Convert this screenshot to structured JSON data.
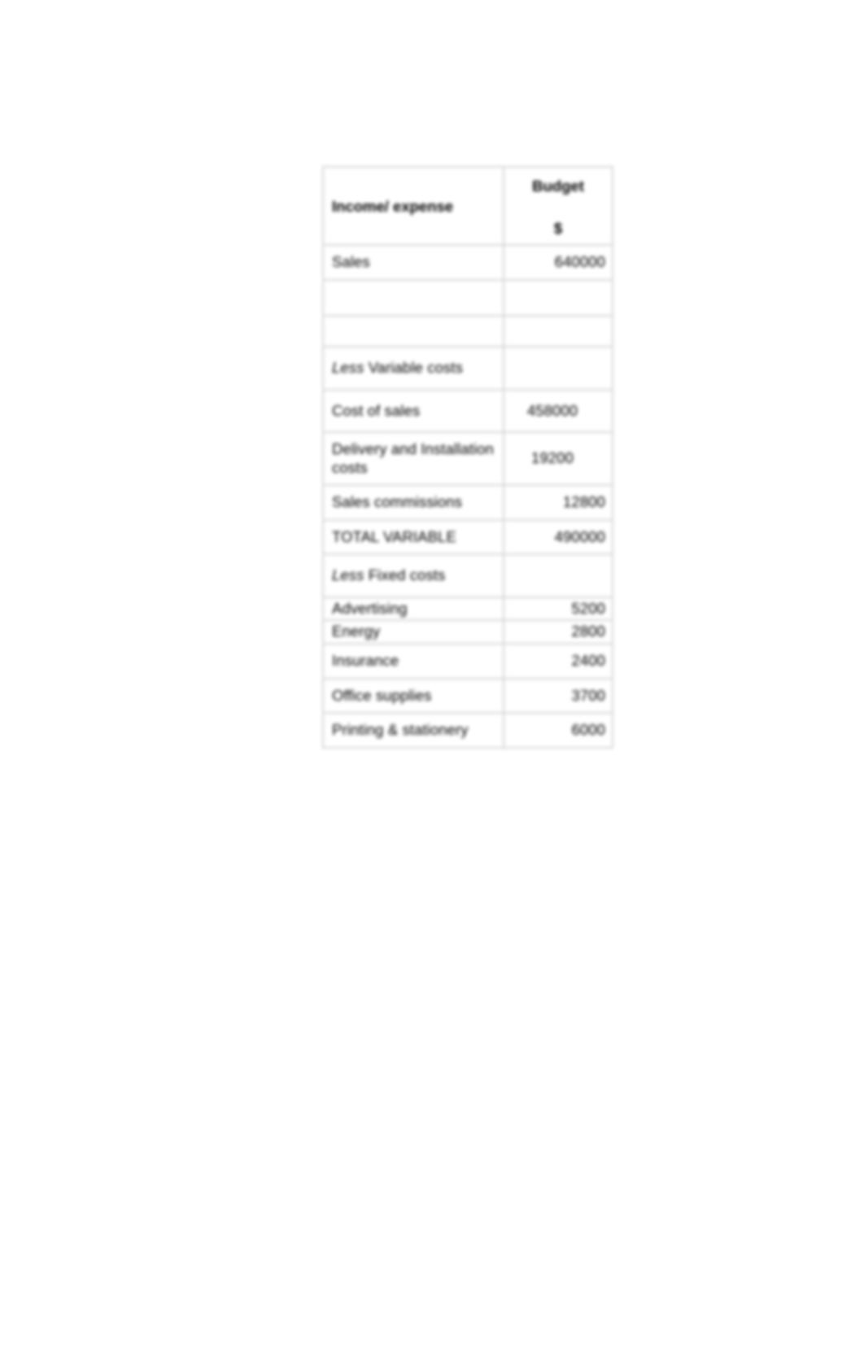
{
  "document": {
    "kind": "budget-statement-table"
  },
  "table": {
    "headers": {
      "label": "Income/ expense",
      "value_title": "Budget",
      "value_unit": "$"
    },
    "rows": [
      {
        "label": "Sales",
        "value": "640000",
        "align": "right",
        "style": "mid",
        "italic_lead": ""
      },
      {
        "label": "",
        "value": "",
        "align": "right",
        "style": "blank",
        "italic_lead": ""
      },
      {
        "label": "",
        "value": "",
        "align": "right",
        "style": "blank2",
        "italic_lead": ""
      },
      {
        "label": "Variable costs",
        "value": "",
        "align": "right",
        "style": "tall",
        "italic_lead": "Less"
      },
      {
        "label": "Cost of sales",
        "value": "458000",
        "align": "center",
        "style": "tall",
        "italic_lead": ""
      },
      {
        "label": "Delivery and Installation costs",
        "value": "19200",
        "align": "center",
        "style": "mid",
        "italic_lead": ""
      },
      {
        "label": "Sales commissions",
        "value": "12800",
        "align": "right",
        "style": "mid",
        "italic_lead": ""
      },
      {
        "label": "TOTAL VARIABLE",
        "value": "490000",
        "align": "right",
        "style": "mid",
        "italic_lead": ""
      },
      {
        "label": "Fixed costs",
        "value": "",
        "align": "right",
        "style": "tall",
        "italic_lead": "Less"
      },
      {
        "label": "Advertising",
        "value": "5200",
        "align": "right",
        "style": "tight",
        "italic_lead": ""
      },
      {
        "label": "Energy",
        "value": "2800",
        "align": "right",
        "style": "tight",
        "italic_lead": ""
      },
      {
        "label": "Insurance",
        "value": "2400",
        "align": "right",
        "style": "mid",
        "italic_lead": ""
      },
      {
        "label": "Office supplies",
        "value": "3700",
        "align": "right",
        "style": "mid",
        "italic_lead": ""
      },
      {
        "label": "Printing & stationery",
        "value": "6000",
        "align": "right",
        "style": "mid",
        "italic_lead": ""
      }
    ]
  },
  "colors": {
    "page_background": "#ffffff",
    "text": "#000000",
    "grid_line": "#d4d4d4"
  }
}
